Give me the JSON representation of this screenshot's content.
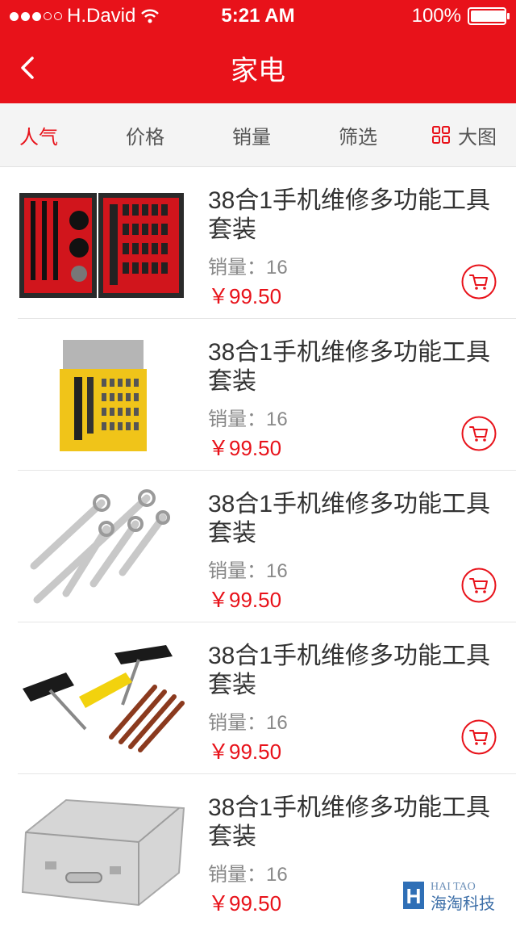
{
  "status_bar": {
    "carrier": "H.David",
    "time": "5:21 AM",
    "battery": "100%",
    "battery_level": 1.0
  },
  "nav": {
    "title": "家电"
  },
  "tabs": [
    {
      "label": "人气",
      "active": true
    },
    {
      "label": "价格"
    },
    {
      "label": "销量"
    },
    {
      "label": "筛选"
    },
    {
      "label": "大图",
      "icon": "grid-icon"
    }
  ],
  "products": [
    {
      "name": "38合1手机维修多功能工具套装",
      "sales": "销量：16",
      "price": "￥99.50",
      "image": "tool-case-red"
    },
    {
      "name": "38合1手机维修多功能工具套装",
      "sales": "销量：16",
      "price": "￥99.50",
      "image": "screwdriver-set-yellow"
    },
    {
      "name": "38合1手机维修多功能工具套装",
      "sales": "销量：16",
      "price": "￥99.50",
      "image": "wrench-set"
    },
    {
      "name": "38合1手机维修多功能工具套装",
      "sales": "销量：16",
      "price": "￥99.50",
      "image": "tire-repair-kit"
    },
    {
      "name": "38合1手机维修多功能工具套装",
      "sales": "销量：16",
      "price": "￥99.50",
      "image": "aluminum-case"
    }
  ],
  "watermark": {
    "line1": "HAI TAO",
    "line2": "海淘科技"
  },
  "colors": {
    "accent": "#e8121a",
    "tab_bg": "#f4f4f4"
  }
}
